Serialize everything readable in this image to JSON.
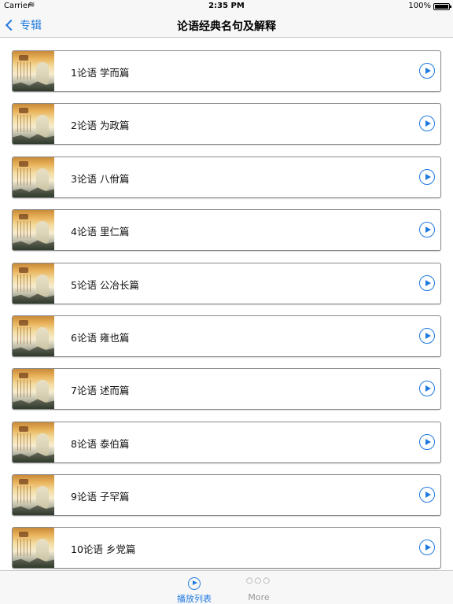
{
  "status_bar": {
    "carrier": "Carrier",
    "wifi_icon": "wifi-icon",
    "time": "2:35 PM",
    "battery": "100%"
  },
  "nav": {
    "back_label": "专辑",
    "title": "论语经典名句及解释"
  },
  "list": {
    "items": [
      {
        "label": "1论语 学而篇"
      },
      {
        "label": "2论语 为政篇"
      },
      {
        "label": "3论语 八佾篇"
      },
      {
        "label": "4论语 里仁篇"
      },
      {
        "label": "5论语 公冶长篇"
      },
      {
        "label": "6论语 雍也篇"
      },
      {
        "label": "7论语 述而篇"
      },
      {
        "label": "8论语 泰伯篇"
      },
      {
        "label": "9论语 子罕篇"
      },
      {
        "label": "10论语 乡党篇"
      }
    ]
  },
  "tab_bar": {
    "tabs": [
      {
        "label": "播放列表",
        "icon": "play-circle-icon",
        "selected": true
      },
      {
        "label": "More",
        "icon": "more-dots-icon",
        "selected": false
      }
    ]
  },
  "colors": {
    "accent": "#1f7ae0",
    "bar_background": "#f7f7f7",
    "row_border": "#8a8a8a"
  }
}
